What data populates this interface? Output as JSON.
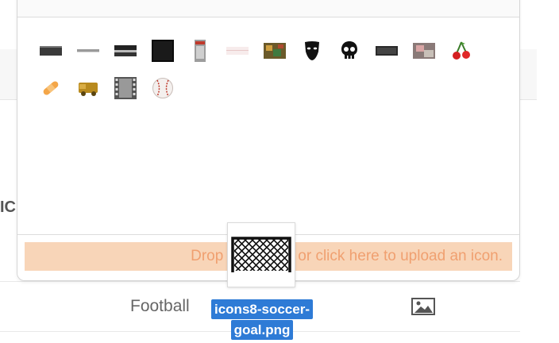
{
  "icon_picker": {
    "icons": [
      {
        "name": "dark-bar-icon"
      },
      {
        "name": "thin-line-icon"
      },
      {
        "name": "black-band-icon"
      },
      {
        "name": "black-square-icon"
      },
      {
        "name": "grey-phone-icon"
      },
      {
        "name": "pale-strip-icon"
      },
      {
        "name": "colorful-painting-icon"
      },
      {
        "name": "theater-mask-icon"
      },
      {
        "name": "skull-icon"
      },
      {
        "name": "dark-rectangle-icon"
      },
      {
        "name": "pinkish-photo-icon"
      },
      {
        "name": "cherries-icon"
      },
      {
        "name": "bandage-icon"
      },
      {
        "name": "golden-truck-icon"
      },
      {
        "name": "film-strip-icon"
      },
      {
        "name": "baseball-icon"
      }
    ],
    "dropzone_text": "Drop a file here or click here to upload an icon."
  },
  "drag_ghost": {
    "filename_line1": "icons8-soccer-",
    "filename_line2": "goal.png",
    "thumbnail_icon": "soccer-goal-icon"
  },
  "background": {
    "truncated_label": "IC",
    "row_label": "Football",
    "row_icon": "image-icon"
  },
  "colors": {
    "dropzone_bg": "#f8d5b8",
    "dropzone_text": "#f0a070",
    "selection_blue": "#2e7bd6"
  }
}
